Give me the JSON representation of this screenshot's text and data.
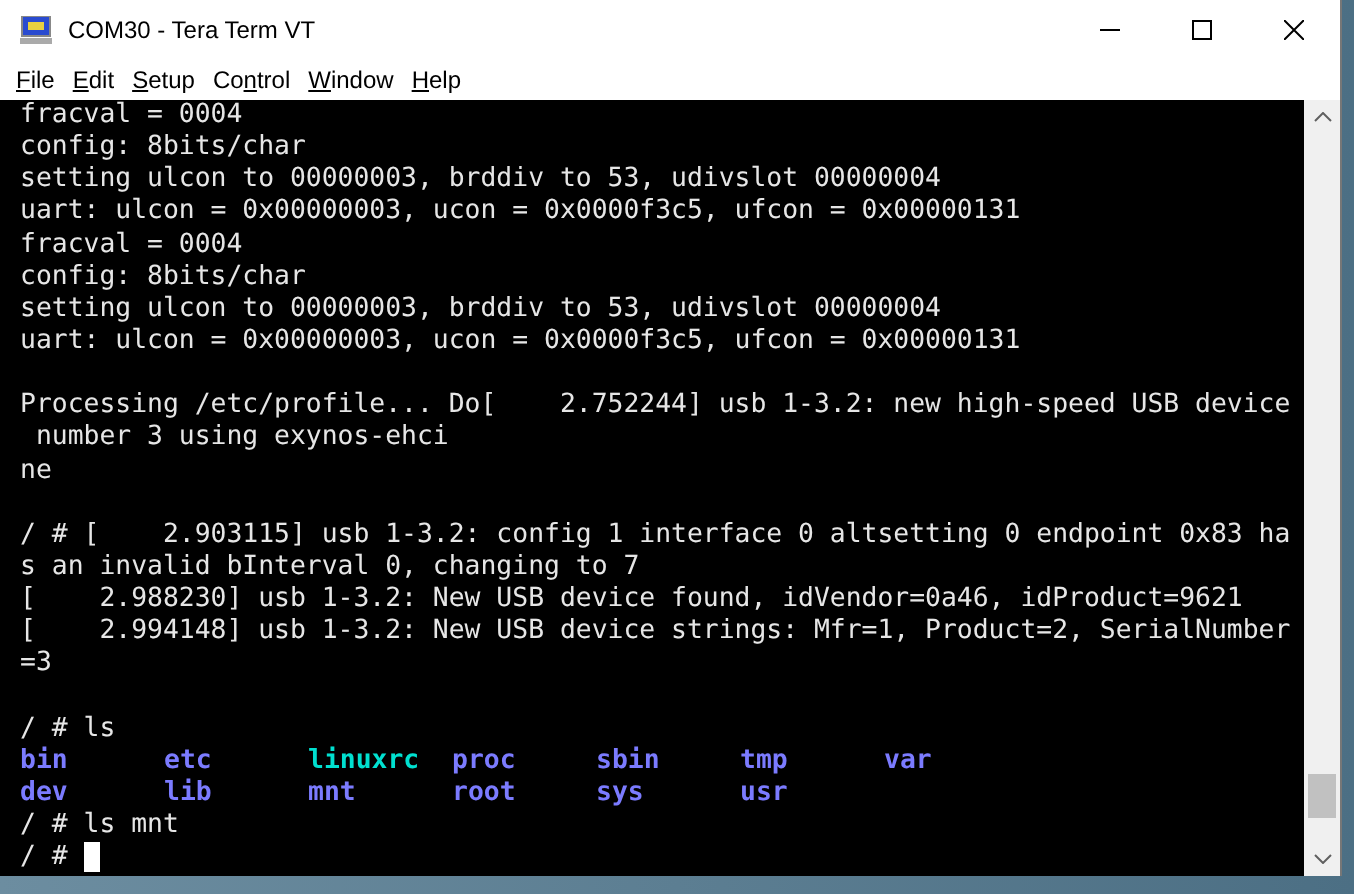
{
  "window": {
    "title": "COM30 - Tera Term VT"
  },
  "menu": [
    {
      "key": "F",
      "post": "ile"
    },
    {
      "key": "E",
      "post": "dit"
    },
    {
      "key": "S",
      "post": "etup"
    },
    {
      "pre": "Co",
      "key": "n",
      "post": "trol"
    },
    {
      "key": "W",
      "post": "indow"
    },
    {
      "key": "H",
      "post": "elp"
    }
  ],
  "terminal": {
    "lines": [
      {
        "kind": "text",
        "text": "fracval = 0004"
      },
      {
        "kind": "text",
        "text": "config: 8bits/char"
      },
      {
        "kind": "text",
        "text": "setting ulcon to 00000003, brddiv to 53, udivslot 00000004"
      },
      {
        "kind": "text",
        "text": "uart: ulcon = 0x00000003, ucon = 0x0000f3c5, ufcon = 0x00000131"
      },
      {
        "kind": "text",
        "text": "fracval = 0004"
      },
      {
        "kind": "text",
        "text": "config: 8bits/char"
      },
      {
        "kind": "text",
        "text": "setting ulcon to 00000003, brddiv to 53, udivslot 00000004"
      },
      {
        "kind": "text",
        "text": "uart: ulcon = 0x00000003, ucon = 0x0000f3c5, ufcon = 0x00000131"
      },
      {
        "kind": "blank"
      },
      {
        "kind": "text",
        "text": "Processing /etc/profile... Do[    2.752244] usb 1-3.2: new high-speed USB device"
      },
      {
        "kind": "text",
        "text": " number 3 using exynos-ehci"
      },
      {
        "kind": "text",
        "text": "ne"
      },
      {
        "kind": "blank"
      },
      {
        "kind": "text",
        "text": "/ # [    2.903115] usb 1-3.2: config 1 interface 0 altsetting 0 endpoint 0x83 ha"
      },
      {
        "kind": "text",
        "text": "s an invalid bInterval 0, changing to 7"
      },
      {
        "kind": "text",
        "text": "[    2.988230] usb 1-3.2: New USB device found, idVendor=0a46, idProduct=9621"
      },
      {
        "kind": "text",
        "text": "[    2.994148] usb 1-3.2: New USB device strings: Mfr=1, Product=2, SerialNumber"
      },
      {
        "kind": "text",
        "text": "=3"
      },
      {
        "kind": "blank"
      },
      {
        "kind": "text",
        "text": "/ # ls"
      },
      {
        "kind": "listing",
        "entries": [
          {
            "name": "bin",
            "color": "#7b7bff"
          },
          {
            "name": "etc",
            "color": "#7b7bff"
          },
          {
            "name": "linuxrc",
            "color": "#00e0d0"
          },
          {
            "name": "proc",
            "color": "#7b7bff"
          },
          {
            "name": "sbin",
            "color": "#7b7bff"
          },
          {
            "name": "tmp",
            "color": "#7b7bff"
          },
          {
            "name": "var",
            "color": "#7b7bff"
          }
        ]
      },
      {
        "kind": "listing",
        "entries": [
          {
            "name": "dev",
            "color": "#7b7bff"
          },
          {
            "name": "lib",
            "color": "#7b7bff"
          },
          {
            "name": "mnt",
            "color": "#7b7bff"
          },
          {
            "name": "root",
            "color": "#7b7bff"
          },
          {
            "name": "sys",
            "color": "#7b7bff"
          },
          {
            "name": "usr",
            "color": "#7b7bff"
          }
        ]
      },
      {
        "kind": "text",
        "text": "/ # ls mnt"
      },
      {
        "kind": "prompt",
        "text": "/ #",
        "cursor": true
      }
    ]
  }
}
